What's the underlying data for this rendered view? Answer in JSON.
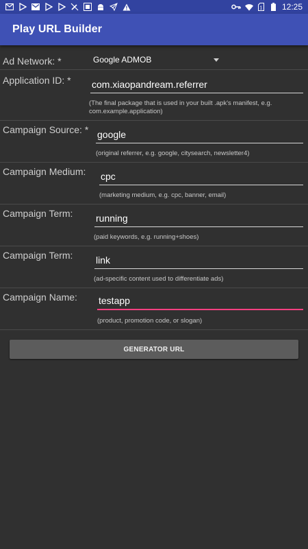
{
  "status_bar": {
    "clock": "12:25",
    "left_icons": [
      "mail-icon",
      "play-store-icon",
      "gmail-icon",
      "play-store-icon",
      "play-store-icon",
      "no-edit-icon",
      "android-icon",
      "android-icon",
      "rocket-icon",
      "warning-icon"
    ],
    "right_icons": [
      "vpn-key-icon",
      "wifi-icon",
      "sim-icon",
      "battery-icon"
    ]
  },
  "app_bar": {
    "title": "Play URL Builder"
  },
  "form": {
    "ad_network": {
      "label": "Ad Network: *",
      "value": "Google ADMOB"
    },
    "application_id": {
      "label": "Application ID: *",
      "value": "com.xiaopandream.referrer",
      "hint": "(The final package that is used in your built .apk's manifest, e.g. com.example.application)"
    },
    "campaign_source": {
      "label": "Campaign Source: *",
      "value": "google",
      "hint": "(original referrer, e.g. google, citysearch, newsletter4)"
    },
    "campaign_medium": {
      "label": "Campaign Medium:",
      "value": "cpc",
      "hint": "(marketing medium, e.g. cpc, banner, email)"
    },
    "campaign_term": {
      "label": "Campaign Term:",
      "value": "running",
      "hint": "(paid keywords, e.g. running+shoes)"
    },
    "campaign_content": {
      "label": "Campaign Term:",
      "value": "link",
      "hint": "(ad-specific content used to differentiate ads)"
    },
    "campaign_name": {
      "label": "Campaign Name:",
      "value": "testapp",
      "hint": "(product, promotion code, or slogan)"
    }
  },
  "generate_button": {
    "label": "GENERATOR URL"
  },
  "colors": {
    "primary": "#3f51b5",
    "primary_dark": "#3243a0",
    "accent": "#ff4081",
    "background": "#303030"
  }
}
